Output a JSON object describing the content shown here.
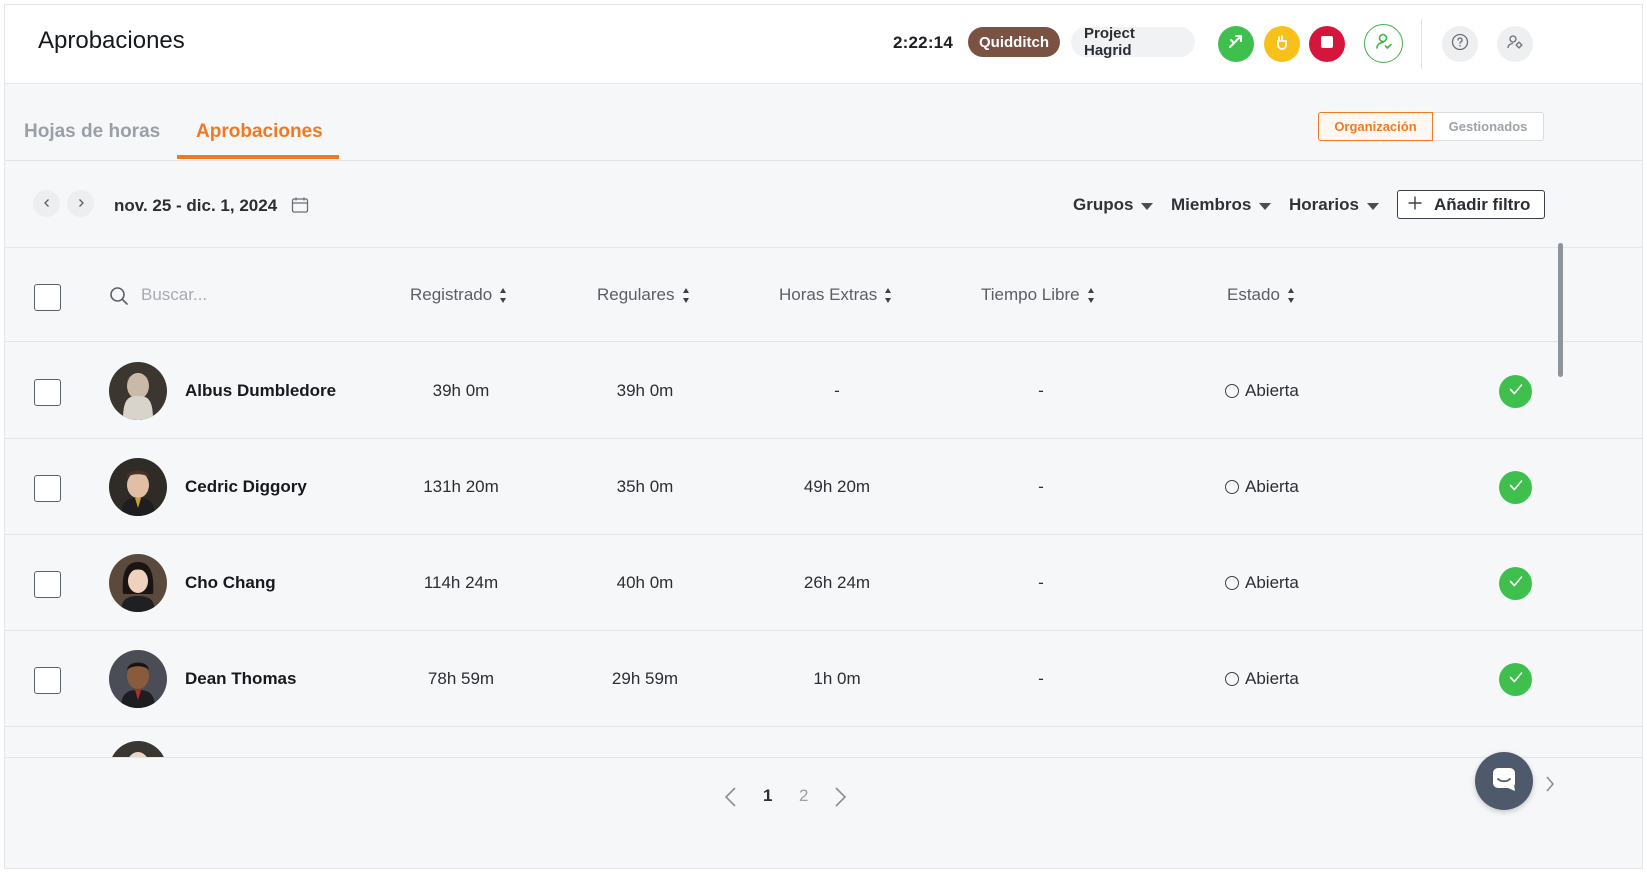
{
  "header": {
    "title": "Aprobaciones",
    "timer": "2:22:14",
    "project_active": "Quidditch",
    "project_secondary": "Project Hagrid",
    "icons": [
      "switch-icon",
      "break-icon",
      "stop-icon",
      "user-check-icon",
      "help-icon",
      "settings-user-icon"
    ]
  },
  "tabs": [
    {
      "label": "Hojas de horas",
      "active": false
    },
    {
      "label": "Aprobaciones",
      "active": true
    }
  ],
  "scope_toggle": {
    "options": [
      "Organización",
      "Gestionados"
    ],
    "selected": "Organización"
  },
  "toolbar": {
    "date_range": "nov. 25 - dic. 1, 2024",
    "filters": [
      "Grupos",
      "Miembros",
      "Horarios"
    ],
    "add_filter_label": "Añadir filtro"
  },
  "table": {
    "search_placeholder": "Buscar...",
    "columns": [
      "Registrado",
      "Regulares",
      "Horas Extras",
      "Tiempo Libre",
      "Estado"
    ],
    "rows": [
      {
        "name": "Albus Dumbledore",
        "registrado": "39h 0m",
        "regulares": "39h 0m",
        "extras": "-",
        "libre": "-",
        "estado": "Abierta"
      },
      {
        "name": "Cedric Diggory",
        "registrado": "131h 20m",
        "regulares": "35h 0m",
        "extras": "49h 20m",
        "libre": "-",
        "estado": "Abierta"
      },
      {
        "name": "Cho Chang",
        "registrado": "114h 24m",
        "regulares": "40h 0m",
        "extras": "26h 24m",
        "libre": "-",
        "estado": "Abierta"
      },
      {
        "name": "Dean Thomas",
        "registrado": "78h 59m",
        "regulares": "29h 59m",
        "extras": "1h 0m",
        "libre": "-",
        "estado": "Abierta"
      }
    ]
  },
  "pagination": {
    "pages": [
      "1",
      "2"
    ],
    "current": "1"
  },
  "colors": {
    "accent": "#f07a22",
    "approve_green": "#3fbf4e",
    "stop_red": "#d4163c",
    "break_yellow": "#f7c11a",
    "project_brown": "#7a5244"
  }
}
